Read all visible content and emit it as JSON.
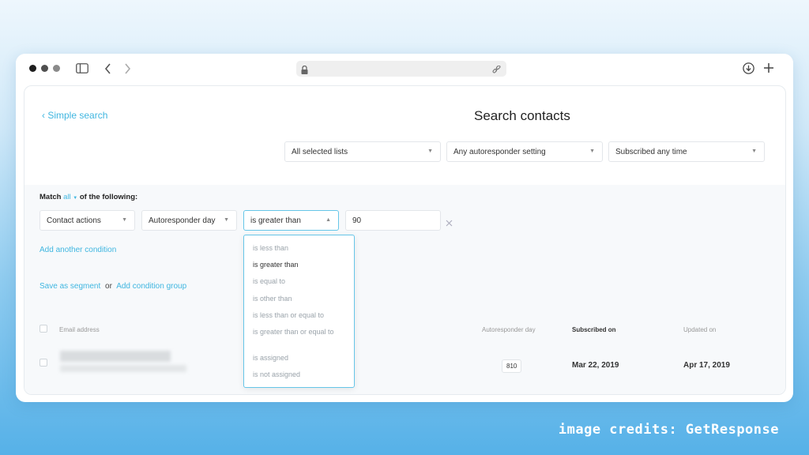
{
  "toolbar": {
    "dots": [
      "#1e1e1e",
      "#4f4f4f",
      "#8a8a8a"
    ],
    "sidebar_icon": "sidebar-icon",
    "back_icon": "chevron-left-icon",
    "forward_icon": "chevron-right-icon",
    "lock_icon": "lock-icon",
    "link_icon": "link-icon",
    "download_icon": "download-icon",
    "new_tab_icon": "plus-icon"
  },
  "page": {
    "back_link": "Simple search",
    "title": "Search contacts"
  },
  "filters": {
    "lists": "All selected lists",
    "autoresponder": "Any autoresponder setting",
    "subscribed": "Subscribed any time"
  },
  "match": {
    "prefix": "Match",
    "mode": "all",
    "suffix": "of the following:"
  },
  "condition": {
    "type": "Contact actions",
    "field": "Autoresponder day",
    "operator": "is greater than",
    "value": "90"
  },
  "operator_options": [
    "is less than",
    "is greater than",
    "is equal to",
    "is other than",
    "is less than or equal to",
    "is greater than or equal to",
    "is assigned",
    "is not assigned"
  ],
  "actions": {
    "add_condition": "Add another condition",
    "save_segment": "Save as segment",
    "or": "or",
    "add_group": "Add condition group"
  },
  "table": {
    "columns": [
      "Email address",
      "Autoresponder day",
      "Subscribed on",
      "Updated on"
    ],
    "rows": [
      {
        "autoresponder_day": "810",
        "subscribed_on": "Mar 22, 2019",
        "updated_on": "Apr 17, 2019"
      }
    ]
  },
  "credits": "image credits: GetResponse",
  "colors": {
    "accent": "#3fb6e0",
    "background_gradient_end": "#56b1e8"
  }
}
